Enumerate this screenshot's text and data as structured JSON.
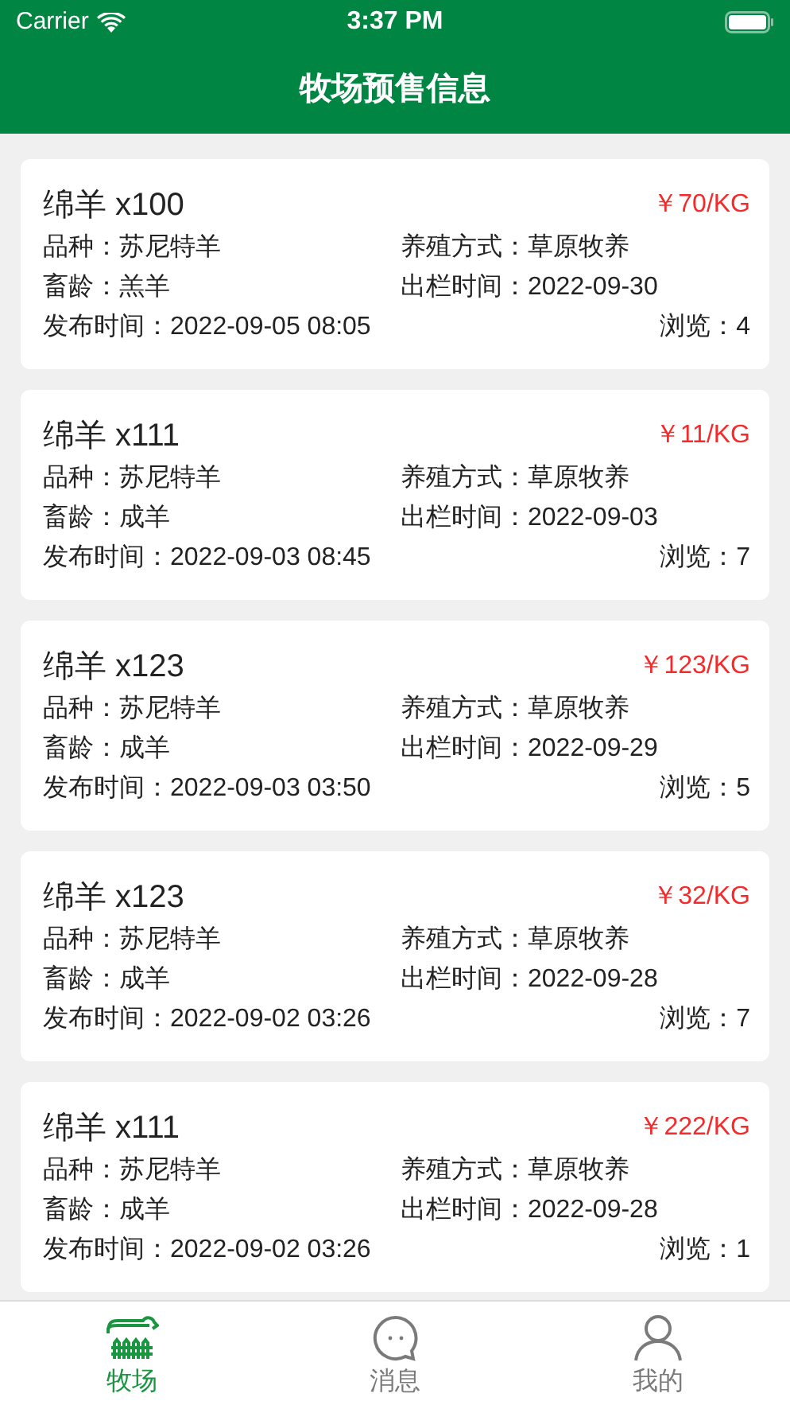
{
  "status_bar": {
    "carrier": "Carrier",
    "time": "3:37 PM"
  },
  "nav": {
    "title": "牧场预售信息"
  },
  "listings": [
    {
      "title": "绵羊 x100",
      "price": "￥70/KG",
      "breed": "品种：苏尼特羊",
      "method": "养殖方式：草原牧养",
      "age": "畜龄：羔羊",
      "out_time": "出栏时间：2022-09-30",
      "published": "发布时间：2022-09-05 08:05",
      "views": "浏览：4"
    },
    {
      "title": "绵羊 x111",
      "price": "￥11/KG",
      "breed": "品种：苏尼特羊",
      "method": "养殖方式：草原牧养",
      "age": "畜龄：成羊",
      "out_time": "出栏时间：2022-09-03",
      "published": "发布时间：2022-09-03 08:45",
      "views": "浏览：7"
    },
    {
      "title": "绵羊 x123",
      "price": "￥123/KG",
      "breed": "品种：苏尼特羊",
      "method": "养殖方式：草原牧养",
      "age": "畜龄：成羊",
      "out_time": "出栏时间：2022-09-29",
      "published": "发布时间：2022-09-03 03:50",
      "views": "浏览：5"
    },
    {
      "title": "绵羊 x123",
      "price": "￥32/KG",
      "breed": "品种：苏尼特羊",
      "method": "养殖方式：草原牧养",
      "age": "畜龄：成羊",
      "out_time": "出栏时间：2022-09-28",
      "published": "发布时间：2022-09-02 03:26",
      "views": "浏览：7"
    },
    {
      "title": "绵羊 x111",
      "price": "￥222/KG",
      "breed": "品种：苏尼特羊",
      "method": "养殖方式：草原牧养",
      "age": "畜龄：成羊",
      "out_time": "出栏时间：2022-09-28",
      "published": "发布时间：2022-09-02 03:26",
      "views": "浏览：1"
    }
  ],
  "tabs": [
    {
      "kind": "ranch",
      "label": "牧场",
      "selected": true
    },
    {
      "kind": "messages",
      "label": "消息",
      "selected": false
    },
    {
      "kind": "profile",
      "label": "我的",
      "selected": false
    }
  ]
}
